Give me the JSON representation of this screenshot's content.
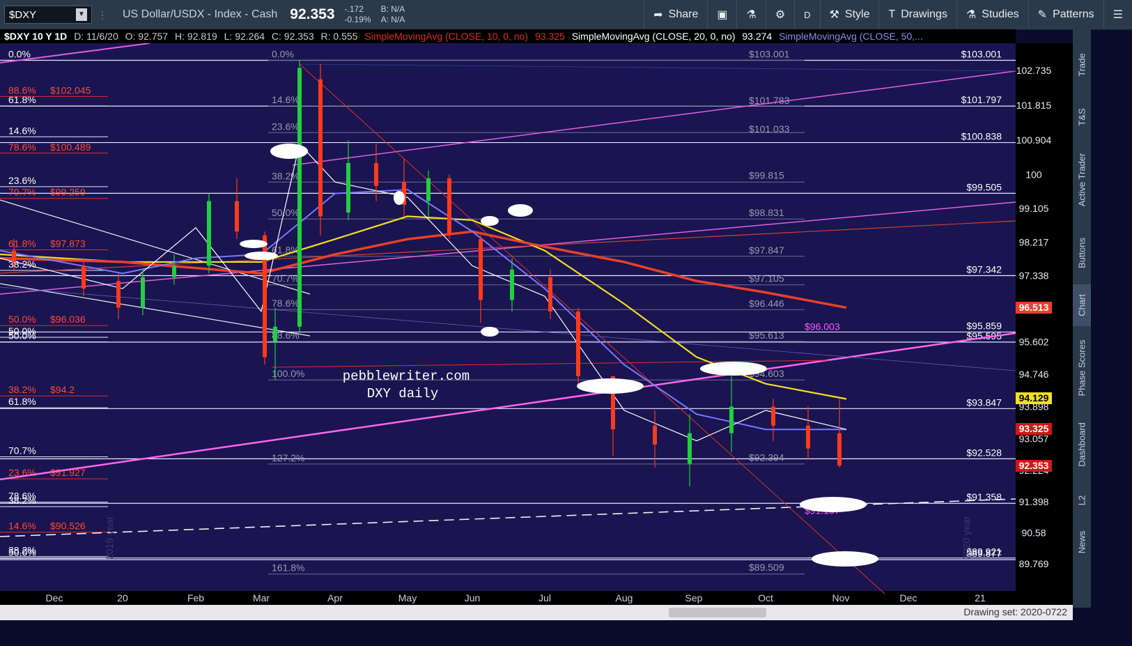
{
  "toolbar": {
    "symbol": "$DXY",
    "description": "US Dollar/USDX - Index - Cash",
    "last_price": "92.353",
    "change": "-.172",
    "change_pct": "-0.19%",
    "bid": "B: N/A",
    "ask": "A: N/A",
    "buttons": [
      "Share",
      "Style",
      "Drawings",
      "Studies",
      "Patterns"
    ],
    "d_label": "D"
  },
  "infobar": {
    "title": "$DXY 10 Y 1D",
    "date": "D: 11/6/20",
    "open": "O: 92.757",
    "high": "H: 92.819",
    "low": "L: 92.264",
    "close": "C: 92.353",
    "range": "R: 0.555",
    "sma10": "SimpleMovingAvg (CLOSE, 10, 0, no)",
    "sma10_val": "93.325",
    "sma20": "SimpleMovingAvg (CLOSE, 20, 0, no)",
    "sma20_val": "93.274",
    "sma50": "SimpleMovingAvg (CLOSE, 50,..."
  },
  "right_tabs": [
    "Trade",
    "T&S",
    "Active Trader",
    "Buttons",
    "Chart",
    "Phase Scores",
    "Dashboard",
    "L2",
    "News"
  ],
  "bottom": {
    "drawing_set": "Drawing set: 2020-0722"
  },
  "chart_data": {
    "type": "candlestick",
    "watermark_lines": [
      "pebblewriter.com",
      "DXY daily"
    ],
    "x_ticks": [
      "Dec",
      "20",
      "Feb",
      "Mar",
      "Apr",
      "May",
      "Jun",
      "Jul",
      "Aug",
      "Sep",
      "Oct",
      "Nov",
      "Dec",
      "21"
    ],
    "y_ticks": [
      "102.735",
      "101.815",
      "100.904",
      "100",
      "99.105",
      "98.217",
      "97.338",
      "95.602",
      "94.746",
      "93.898",
      "93.057",
      "92.224",
      "91.398",
      "90.58",
      "89.769"
    ],
    "ylim": [
      89.2,
      103.2
    ],
    "price_tags": [
      {
        "label": "96.513",
        "value": 96.513,
        "color": "#e8402a"
      },
      {
        "label": "94.129",
        "value": 94.129,
        "color": "#f0e020"
      },
      {
        "label": "93.325",
        "value": 93.325,
        "color": "#d01818"
      },
      {
        "label": "92.353",
        "value": 92.353,
        "color": "#d01818"
      }
    ],
    "level_labels": [
      {
        "label": "$103.001",
        "value": 103.001
      },
      {
        "label": "$101.797",
        "value": 101.797
      },
      {
        "label": "$100.838",
        "value": 100.838
      },
      {
        "label": "$99.505",
        "value": 99.505
      },
      {
        "label": "$97.342",
        "value": 97.342
      },
      {
        "label": "$95.859",
        "value": 95.859
      },
      {
        "label": "$95.595",
        "value": 95.595
      },
      {
        "label": "$93.847",
        "value": 93.847
      },
      {
        "label": "$92.528",
        "value": 92.528
      },
      {
        "label": "$91.358",
        "value": 91.358
      },
      {
        "label": "$89.921",
        "value": 89.921
      },
      {
        "label": "$89.877",
        "value": 89.877
      }
    ],
    "fib_labels_left_white": [
      {
        "label": "0.0%",
        "value": 103.0
      },
      {
        "label": "61.8%",
        "value": 101.8
      },
      {
        "label": "14.6%",
        "value": 100.99
      },
      {
        "label": "23.6%",
        "value": 99.68
      },
      {
        "label": "38.2%",
        "value": 97.48
      },
      {
        "label": "50.0%",
        "value": 95.72
      },
      {
        "label": "50.0%",
        "value": 95.6
      },
      {
        "label": "61.8%",
        "value": 93.87
      },
      {
        "label": "70.7%",
        "value": 92.58
      },
      {
        "label": "78.6%",
        "value": 91.39
      },
      {
        "label": "38.2%",
        "value": 91.27
      },
      {
        "label": "38.2%",
        "value": 89.96
      },
      {
        "label": "50.0%",
        "value": 89.91
      }
    ],
    "fib_labels_left_red": [
      {
        "label": "88.6%",
        "value": 102.05,
        "price": "$102.045"
      },
      {
        "label": "78.6%",
        "value": 100.56,
        "price": "$100.489"
      },
      {
        "label": "70.7%",
        "value": 99.37,
        "price": "$99.259"
      },
      {
        "label": "61.8%",
        "value": 98.02,
        "price": "$97.873"
      },
      {
        "label": "50.0%",
        "value": 96.03,
        "price": "$96.036"
      },
      {
        "label": "38.2%",
        "value": 94.18,
        "price": "$94.2"
      },
      {
        "label": "23.6%",
        "value": 92.0,
        "price": "$91.927"
      },
      {
        "label": "14.6%",
        "value": 90.6,
        "price": "$90.526"
      }
    ],
    "fib_labels_mid": [
      {
        "label": "0.0%",
        "value": 103.0
      },
      {
        "label": "14.6%",
        "value": 101.8
      },
      {
        "label": "23.6%",
        "value": 101.1
      },
      {
        "label": "38.2%",
        "value": 99.8
      },
      {
        "label": "50.0%",
        "value": 98.83
      },
      {
        "label": "61.8%",
        "value": 97.85
      },
      {
        "label": "70.7%",
        "value": 97.1
      },
      {
        "label": "78.6%",
        "value": 96.45
      },
      {
        "label": "88.6%",
        "value": 95.61
      },
      {
        "label": "100.0%",
        "value": 94.6
      },
      {
        "label": "127.2%",
        "value": 92.39
      },
      {
        "label": "161.8%",
        "value": 89.5
      }
    ],
    "fib_labels_right": [
      {
        "label": "$103.001",
        "value": 103.001
      },
      {
        "label": "$101.783",
        "value": 101.783
      },
      {
        "label": "$101.033",
        "value": 101.033
      },
      {
        "label": "$99.815",
        "value": 99.815
      },
      {
        "label": "$98.831",
        "value": 98.831
      },
      {
        "label": "$97.847",
        "value": 97.847
      },
      {
        "label": "$97.105",
        "value": 97.105
      },
      {
        "label": "$96.446",
        "value": 96.446
      },
      {
        "label": "$95.613",
        "value": 95.613
      },
      {
        "label": "$94.603",
        "value": 94.603
      },
      {
        "label": "$92.394",
        "value": 92.394
      },
      {
        "label": "$89.509",
        "value": 89.509
      }
    ],
    "magenta_labels": [
      {
        "label": "$96.003",
        "value": 96.003
      },
      {
        "label": "$91.167",
        "value": 91.167
      }
    ],
    "year_marks": [
      "2019 year",
      "2020 year"
    ],
    "candles": [
      {
        "x": "Dec 2019",
        "o": 98.0,
        "h": 98.3,
        "l": 97.5,
        "c": 97.7
      },
      {
        "x": "mid Dec",
        "o": 97.6,
        "h": 97.8,
        "l": 96.8,
        "c": 97.0
      },
      {
        "x": "late Dec",
        "o": 97.2,
        "h": 97.4,
        "l": 96.2,
        "c": 96.5
      },
      {
        "x": "Jan 2020",
        "o": 96.5,
        "h": 97.5,
        "l": 96.3,
        "c": 97.3
      },
      {
        "x": "mid Jan",
        "o": 97.3,
        "h": 97.9,
        "l": 97.1,
        "c": 97.6
      },
      {
        "x": "Feb",
        "o": 97.6,
        "h": 99.5,
        "l": 97.4,
        "c": 99.3
      },
      {
        "x": "late Feb",
        "o": 99.3,
        "h": 99.9,
        "l": 98.3,
        "c": 98.5
      },
      {
        "x": "early Mar",
        "o": 98.4,
        "h": 98.5,
        "l": 95.0,
        "c": 95.2
      },
      {
        "x": "Mar low",
        "o": 95.6,
        "h": 96.5,
        "l": 94.6,
        "c": 96.0
      },
      {
        "x": "mid Mar",
        "o": 96.0,
        "h": 103.0,
        "l": 95.8,
        "c": 102.8
      },
      {
        "x": "late Mar",
        "o": 102.5,
        "h": 102.9,
        "l": 98.4,
        "c": 98.9
      },
      {
        "x": "Apr",
        "o": 99.0,
        "h": 100.9,
        "l": 98.8,
        "c": 100.3
      },
      {
        "x": "mid Apr",
        "o": 100.3,
        "h": 100.8,
        "l": 99.3,
        "c": 99.7
      },
      {
        "x": "May",
        "o": 99.8,
        "h": 100.4,
        "l": 98.9,
        "c": 99.2
      },
      {
        "x": "mid May",
        "o": 99.3,
        "h": 100.1,
        "l": 98.9,
        "c": 99.9
      },
      {
        "x": "late May",
        "o": 99.9,
        "h": 100.0,
        "l": 98.3,
        "c": 98.4
      },
      {
        "x": "Jun",
        "o": 98.3,
        "h": 98.4,
        "l": 96.1,
        "c": 96.7
      },
      {
        "x": "mid Jun",
        "o": 96.7,
        "h": 97.8,
        "l": 96.4,
        "c": 97.5
      },
      {
        "x": "Jul",
        "o": 97.3,
        "h": 97.5,
        "l": 96.2,
        "c": 96.4
      },
      {
        "x": "mid Jul",
        "o": 96.4,
        "h": 96.5,
        "l": 94.5,
        "c": 94.7
      },
      {
        "x": "Aug",
        "o": 94.7,
        "h": 94.0,
        "l": 92.6,
        "c": 93.3
      },
      {
        "x": "mid Aug",
        "o": 93.4,
        "h": 93.8,
        "l": 92.3,
        "c": 92.9
      },
      {
        "x": "Sep",
        "o": 92.4,
        "h": 93.7,
        "l": 91.8,
        "c": 93.2
      },
      {
        "x": "mid Sep",
        "o": 93.2,
        "h": 94.7,
        "l": 92.7,
        "c": 93.9
      },
      {
        "x": "Oct",
        "o": 93.9,
        "h": 94.1,
        "l": 93.0,
        "c": 93.4
      },
      {
        "x": "mid Oct",
        "o": 93.4,
        "h": 93.9,
        "l": 92.5,
        "c": 92.8
      },
      {
        "x": "Nov",
        "o": 93.2,
        "h": 94.1,
        "l": 92.3,
        "c": 92.35
      }
    ]
  }
}
